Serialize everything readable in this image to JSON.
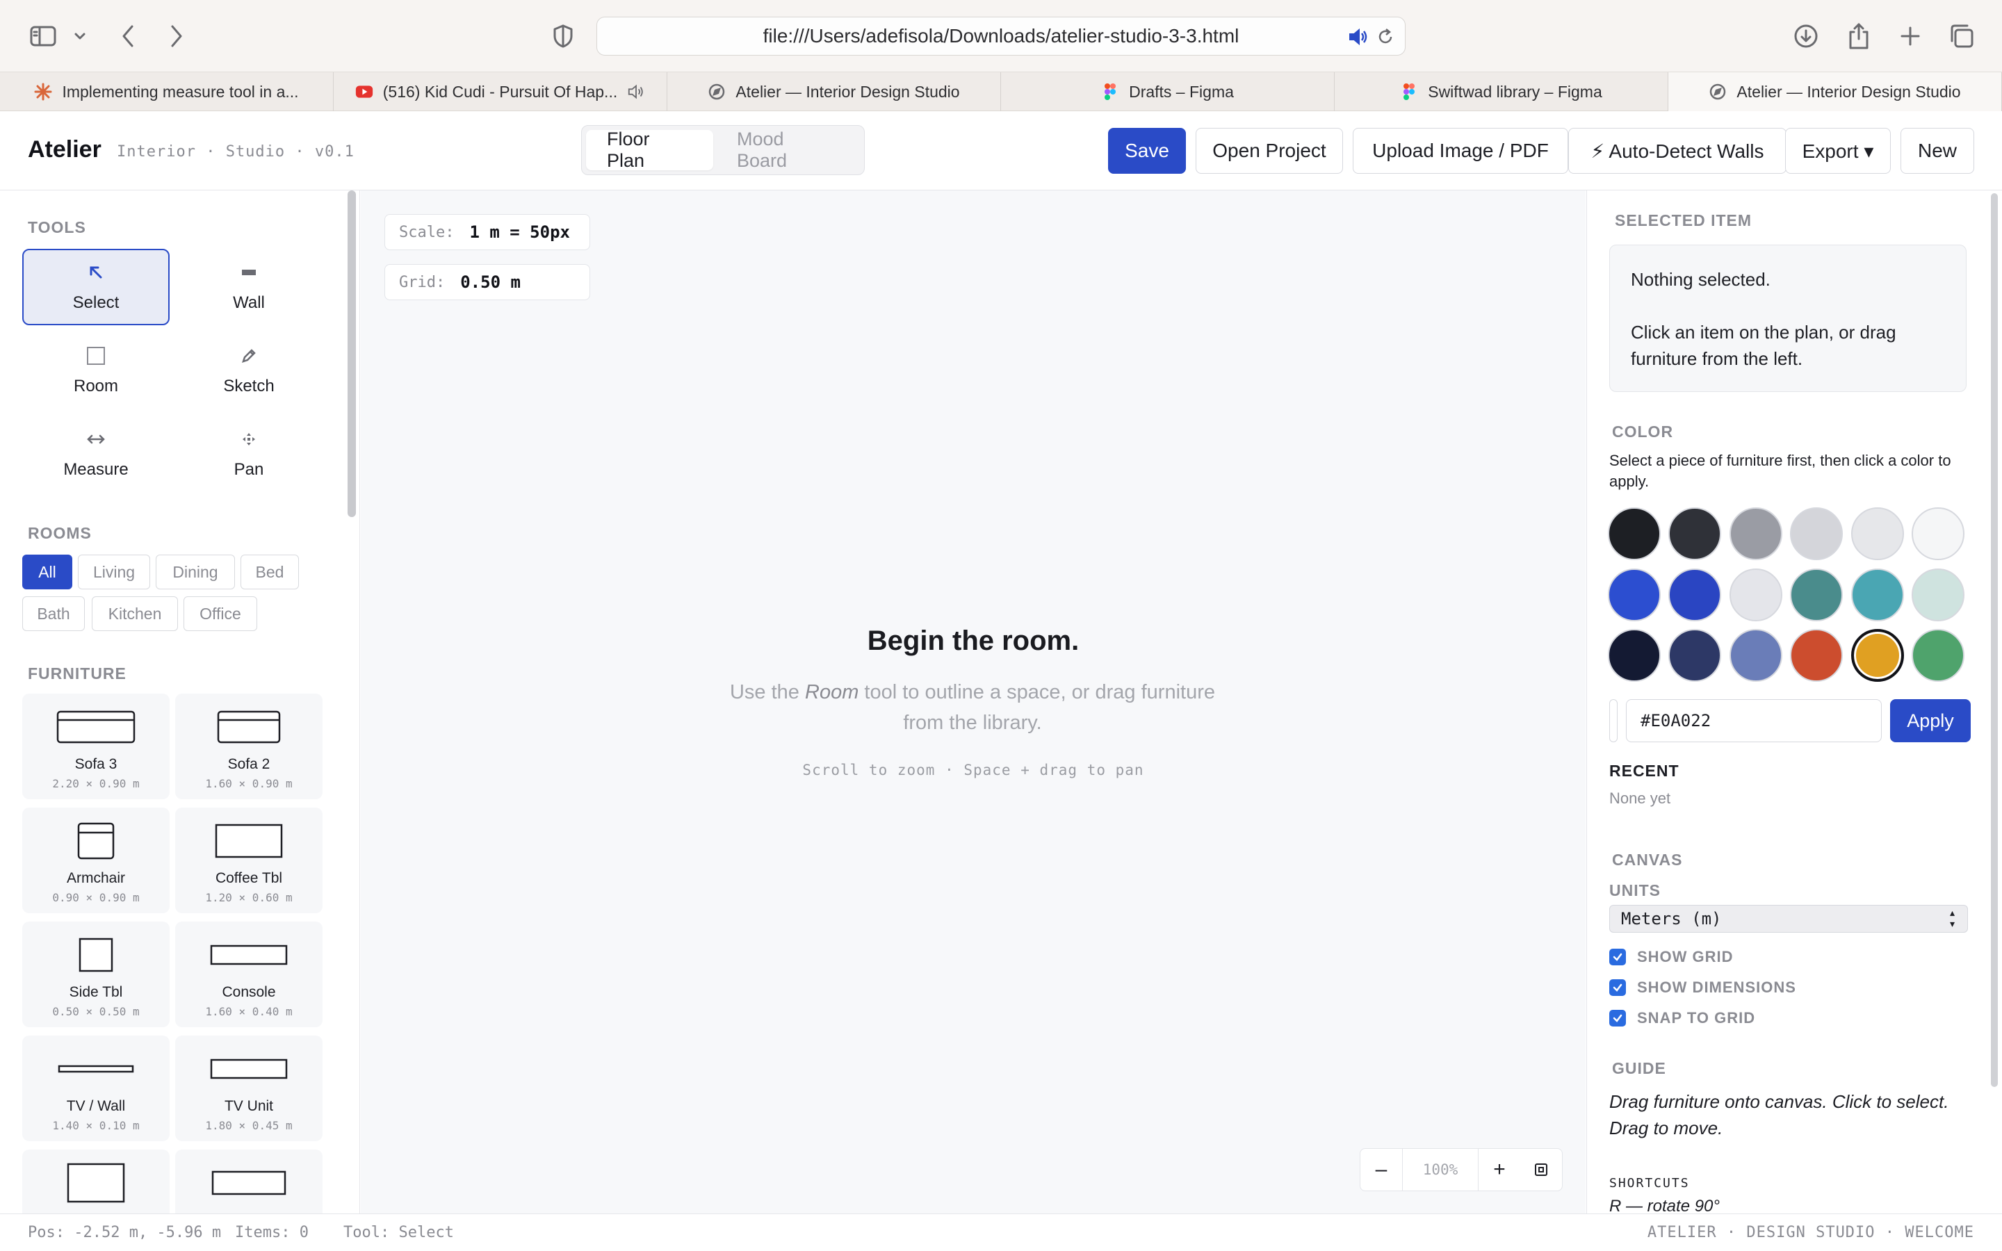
{
  "browser": {
    "url": "file:///Users/adefisola/Downloads/atelier-studio-3-3.html",
    "tabs": [
      {
        "label": "Implementing measure tool in a...",
        "icon": "claude-icon"
      },
      {
        "label": "(516) Kid Cudi - Pursuit Of Hap...",
        "icon": "youtube-icon"
      },
      {
        "label": "Atelier — Interior Design Studio",
        "icon": "compass-icon"
      },
      {
        "label": "Drafts – Figma",
        "icon": "figma-icon"
      },
      {
        "label": "Swiftwad library – Figma",
        "icon": "figma-icon"
      },
      {
        "label": "Atelier — Interior Design Studio",
        "icon": "compass-icon"
      }
    ]
  },
  "header": {
    "brand": "Atelier",
    "subtitle": "Interior · Studio · v0.1",
    "views": {
      "floor_plan": "Floor Plan",
      "mood_board": "Mood Board",
      "active": "Floor Plan"
    },
    "buttons": {
      "save": "Save",
      "open": "Open Project",
      "upload": "Upload Image / PDF",
      "autodetect": "⚡ Auto-Detect Walls",
      "export": "Export ▾",
      "new": "New"
    }
  },
  "sidebar": {
    "tools_title": "TOOLS",
    "tools": [
      {
        "label": "Select",
        "icon": "cursor-arrow-icon",
        "active": true
      },
      {
        "label": "Wall",
        "icon": "wall-icon"
      },
      {
        "label": "Room",
        "icon": "square-icon"
      },
      {
        "label": "Sketch",
        "icon": "pencil-icon"
      },
      {
        "label": "Measure",
        "icon": "arrows-horizontal-icon"
      },
      {
        "label": "Pan",
        "icon": "move-icon"
      }
    ],
    "rooms_title": "ROOMS",
    "rooms": [
      "All",
      "Living",
      "Dining",
      "Bed",
      "Bath",
      "Kitchen",
      "Office"
    ],
    "furniture_title": "FURNITURE",
    "furniture": [
      {
        "name": "Sofa 3",
        "dims": "2.20 × 0.90 m"
      },
      {
        "name": "Sofa 2",
        "dims": "1.60 × 0.90 m"
      },
      {
        "name": "Armchair",
        "dims": "0.90 × 0.90 m"
      },
      {
        "name": "Coffee Tbl",
        "dims": "1.20 × 0.60 m"
      },
      {
        "name": "Side Tbl",
        "dims": "0.50 × 0.50 m"
      },
      {
        "name": "Console",
        "dims": "1.60 × 0.40 m"
      },
      {
        "name": "TV / Wall",
        "dims": "1.40 × 0.10 m"
      },
      {
        "name": "TV Unit",
        "dims": "1.80 × 0.45 m"
      }
    ]
  },
  "canvas": {
    "scale_label": "Scale:",
    "scale_value": "1 m = 50px",
    "grid_label": "Grid:",
    "grid_value": "0.50 m",
    "empty_title": "Begin the room.",
    "empty_body_pre": "Use the",
    "empty_body_em": "Room",
    "empty_body_post": "tool to outline a space, or drag furniture from the library.",
    "empty_hint": "Scroll to zoom · Space + drag to pan",
    "zoom": {
      "minus": "–",
      "value": "100%",
      "plus": "+"
    }
  },
  "panel": {
    "selected_title": "SELECTED ITEM",
    "selected_line1": "Nothing selected.",
    "selected_line2": "Click an item on the plan, or drag furniture from the left.",
    "color_title": "COLOR",
    "color_desc": "Select a piece of furniture first, then click a color to apply.",
    "swatches": [
      "#1d1f24",
      "#2f3138",
      "#9a9ca4",
      "#d4d5da",
      "#e6e7ea",
      "#f5f6f7",
      "#2c4ed0",
      "#2a45c2",
      "#e4e5ea",
      "#4a8c8c",
      "#4aa6b3",
      "#cfe3df",
      "#141a33",
      "#2d3866",
      "#6a7db8",
      "#cc4d2e",
      "#e0a022",
      "#4fa36c"
    ],
    "selected_swatch": "#e0a022",
    "hex_value": "#E0A022",
    "apply": "Apply",
    "recent_title": "RECENT",
    "recent_value": "None yet",
    "canvas_title": "CANVAS",
    "units_title": "UNITS",
    "units_value": "Meters (m)",
    "checks": [
      "SHOW GRID",
      "SHOW DIMENSIONS",
      "SNAP TO GRID"
    ],
    "guide_title": "GUIDE",
    "guide_text": "Drag furniture onto canvas. Click to select. Drag to move.",
    "shortcuts_title": "SHORTCUTS",
    "shortcut_1": "R — rotate 90°"
  },
  "status": {
    "pos": "Pos: -2.52 m, -5.96 m",
    "items": "Items: 0",
    "tool": "Tool: Select",
    "right": "ATELIER · DESIGN STUDIO · WELCOME"
  },
  "colors": {
    "accent": "#2a4bc7",
    "checkbox": "#2a6be0"
  }
}
